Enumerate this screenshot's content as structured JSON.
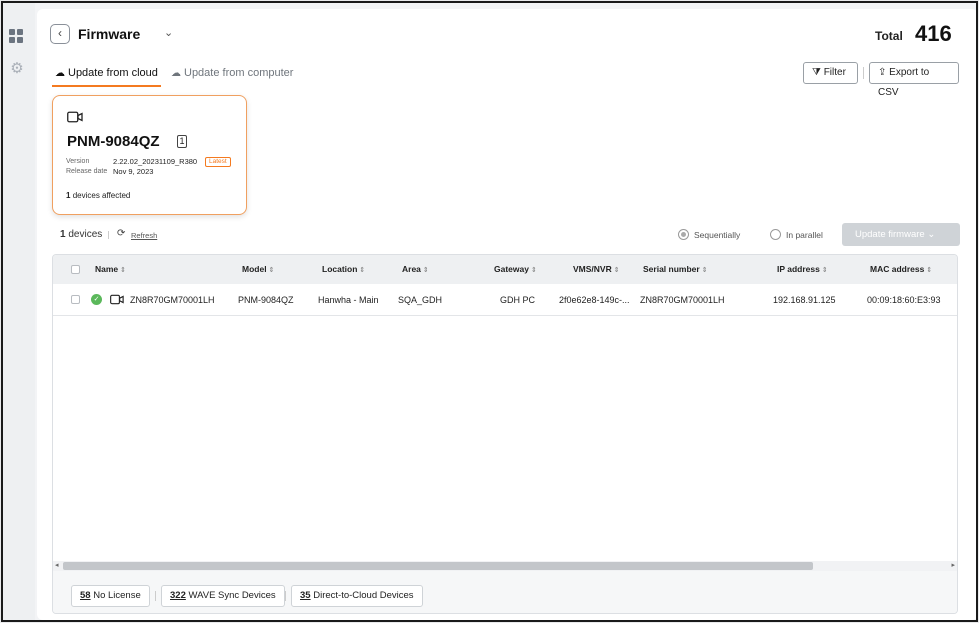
{
  "header": {
    "title": "Firmware",
    "total_label": "Total",
    "total_value": "416"
  },
  "tabs": [
    {
      "label": "Update from cloud",
      "active": true
    },
    {
      "label": "Update from computer",
      "active": false
    }
  ],
  "actions": {
    "filter_label": "Filter",
    "export_label": "Export to CSV"
  },
  "firmware_card": {
    "model": "PNM-9084QZ",
    "count_badge": "1",
    "version_label": "Version",
    "version_value": "2.22.02_20231109_R380",
    "latest_badge": "Latest",
    "release_label": "Release date",
    "release_value": "Nov 9, 2023",
    "affected_count": "1",
    "affected_text": "devices affected"
  },
  "toolbar": {
    "devices_count": "1",
    "devices_label": "devices",
    "refresh_label": "Refresh",
    "sequential_label": "Sequentially",
    "parallel_label": "In parallel",
    "update_button": "Update firmware"
  },
  "table": {
    "columns": [
      "Name",
      "Model",
      "Location",
      "Area",
      "Gateway",
      "VMS/NVR",
      "Serial number",
      "IP address",
      "MAC address"
    ],
    "rows": [
      {
        "name": "ZN8R70GM70001LH",
        "model": "PNM-9084QZ",
        "location": "Hanwha - Main",
        "area": "SQA_GDH",
        "gateway": "GDH PC",
        "vms": "2f0e62e8-149c-...",
        "serial": "ZN8R70GM70001LH",
        "ip": "192.168.91.125",
        "mac": "00:09:18:60:E3:93"
      }
    ]
  },
  "footer": {
    "no_license_count": "58",
    "no_license_label": "No License",
    "wave_count": "322",
    "wave_label": "WAVE Sync Devices",
    "cloud_count": "35",
    "cloud_label": "Direct-to-Cloud Devices"
  },
  "colors": {
    "accent": "#f47a20",
    "status_ok": "#5bb85b",
    "disabled_button": "#cfd3d7"
  }
}
